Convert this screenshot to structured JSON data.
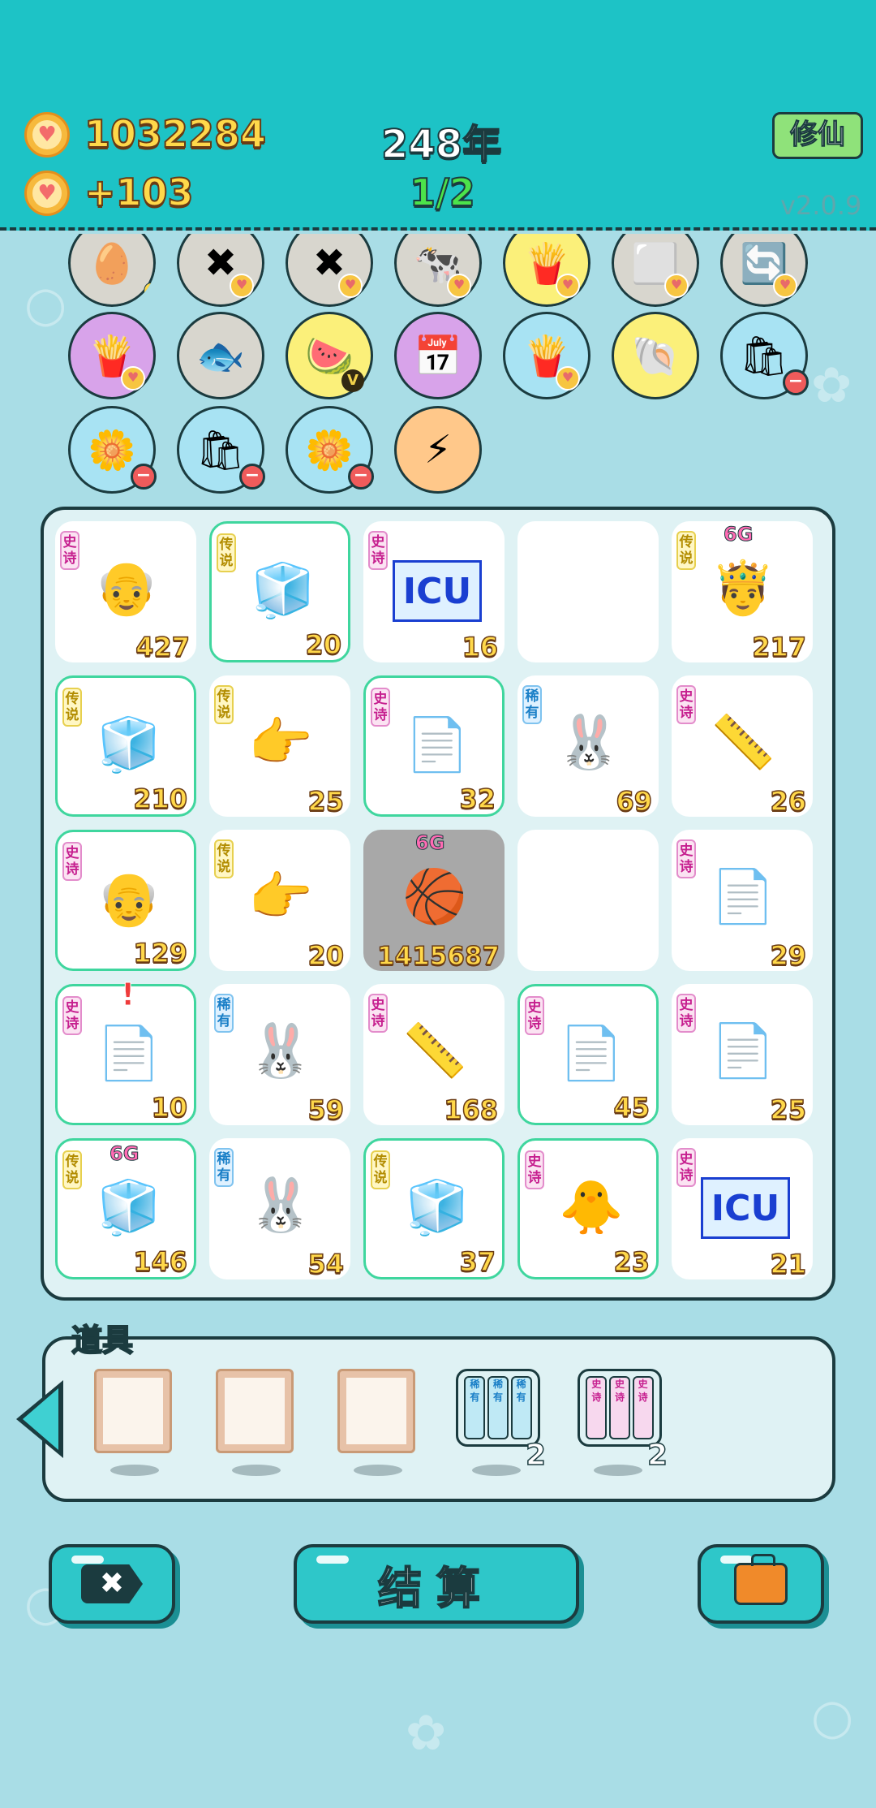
{
  "header": {
    "coins": "1032284",
    "income": "+103",
    "year": "248年",
    "progress": "1/2",
    "xiuxian_label": "修仙",
    "version": "v2.0.9"
  },
  "symbols": [
    {
      "name": "egg-carton",
      "glyph": "🥚",
      "bg": "grey",
      "mark": "zero",
      "mark_text": "0"
    },
    {
      "name": "remove-token",
      "glyph": "✖",
      "bg": "grey",
      "mark": "heart"
    },
    {
      "name": "remove-token",
      "glyph": "✖",
      "bg": "grey",
      "mark": "heart"
    },
    {
      "name": "cows",
      "glyph": "🐄",
      "bg": "grey",
      "mark": "heart"
    },
    {
      "name": "fries",
      "glyph": "🍟",
      "bg": "yellow",
      "mark": "heart"
    },
    {
      "name": "dice-blocks",
      "glyph": "⬜",
      "bg": "grey",
      "mark": "heart"
    },
    {
      "name": "refresh",
      "glyph": "🔄",
      "bg": "grey",
      "mark": "heart"
    },
    {
      "name": "fries",
      "glyph": "🍟",
      "bg": "purple",
      "mark": "heart"
    },
    {
      "name": "fish-bowl",
      "glyph": "🐟",
      "bg": "grey",
      "mark": "none"
    },
    {
      "name": "fruit-basket",
      "glyph": "🍉",
      "bg": "yellow",
      "mark": "v",
      "mark_text": "V"
    },
    {
      "name": "calendar",
      "glyph": "📅",
      "bg": "purple",
      "mark": "none"
    },
    {
      "name": "fries",
      "glyph": "🍟",
      "bg": "blue",
      "mark": "heart"
    },
    {
      "name": "shell",
      "glyph": "🐚",
      "bg": "yellow",
      "mark": "none"
    },
    {
      "name": "trash-bag",
      "glyph": "🛍",
      "bg": "blue",
      "mark": "minus"
    },
    {
      "name": "flower-pot",
      "glyph": "🌼",
      "bg": "blue",
      "mark": "minus"
    },
    {
      "name": "trash-bag",
      "glyph": "🛍",
      "bg": "blue",
      "mark": "minus"
    },
    {
      "name": "flower-pot",
      "glyph": "🌼",
      "bg": "blue",
      "mark": "minus"
    },
    {
      "name": "lightning",
      "glyph": "⚡",
      "bg": "orange",
      "mark": "none"
    }
  ],
  "grid": [
    {
      "tag": "史诗",
      "tag_type": "epic",
      "icon": "old-man",
      "glyph": "👴",
      "value": "427",
      "green": false
    },
    {
      "tag": "传说",
      "tag_type": "legend",
      "icon": "fridge",
      "glyph": "🧊",
      "value": "20",
      "green": true
    },
    {
      "tag": "史诗",
      "tag_type": "epic",
      "icon": "icu",
      "glyph": "ICU",
      "value": "16",
      "green": false
    },
    {
      "tag": "",
      "tag_type": "",
      "icon": "empty",
      "glyph": "",
      "value": "",
      "green": false
    },
    {
      "tag": "传说",
      "tag_type": "legend",
      "icon": "crowned-man",
      "glyph": "🤴",
      "value": "217",
      "green": false,
      "badge": "6G"
    },
    {
      "tag": "传说",
      "tag_type": "legend",
      "icon": "fridge",
      "glyph": "🧊",
      "value": "210",
      "green": true
    },
    {
      "tag": "传说",
      "tag_type": "legend",
      "icon": "pointing-hand-ball",
      "glyph": "👉",
      "value": "25",
      "green": false
    },
    {
      "tag": "史诗",
      "tag_type": "epic",
      "icon": "copy-paste",
      "glyph": "📄",
      "value": "32",
      "green": true
    },
    {
      "tag": "稀有",
      "tag_type": "rare",
      "icon": "rabbit",
      "glyph": "🐰",
      "value": "69",
      "green": false
    },
    {
      "tag": "史诗",
      "tag_type": "epic",
      "icon": "ruler",
      "glyph": "📏",
      "value": "26",
      "green": false
    },
    {
      "tag": "史诗",
      "tag_type": "epic",
      "icon": "old-man",
      "glyph": "👴",
      "value": "129",
      "green": true
    },
    {
      "tag": "传说",
      "tag_type": "legend",
      "icon": "pointing-hand",
      "glyph": "👉",
      "value": "20",
      "green": false
    },
    {
      "tag": "",
      "tag_type": "",
      "icon": "fridge-basketball",
      "glyph": "🏀",
      "value": "1415687",
      "green": false,
      "grey": true,
      "badge": "6G"
    },
    {
      "tag": "",
      "tag_type": "",
      "icon": "empty",
      "glyph": "",
      "value": "",
      "green": false
    },
    {
      "tag": "史诗",
      "tag_type": "epic",
      "icon": "copy-paste",
      "glyph": "📄",
      "value": "29",
      "green": false
    },
    {
      "tag": "史诗",
      "tag_type": "epic",
      "icon": "copy-paste",
      "glyph": "📄",
      "value": "10",
      "green": true,
      "alert": "!"
    },
    {
      "tag": "稀有",
      "tag_type": "rare",
      "icon": "rabbit",
      "glyph": "🐰",
      "value": "59",
      "green": false
    },
    {
      "tag": "史诗",
      "tag_type": "epic",
      "icon": "ruler",
      "glyph": "📏",
      "value": "168",
      "green": false
    },
    {
      "tag": "史诗",
      "tag_type": "epic",
      "icon": "copy-paste",
      "glyph": "📄",
      "value": "45",
      "green": true
    },
    {
      "tag": "史诗",
      "tag_type": "epic",
      "icon": "copy-paste",
      "glyph": "📄",
      "value": "25",
      "green": false
    },
    {
      "tag": "传说",
      "tag_type": "legend",
      "icon": "fridge",
      "glyph": "🧊",
      "value": "146",
      "green": true,
      "badge": "6G"
    },
    {
      "tag": "稀有",
      "tag_type": "rare",
      "icon": "rabbit",
      "glyph": "🐰",
      "value": "54",
      "green": false
    },
    {
      "tag": "传说",
      "tag_type": "legend",
      "icon": "fridge",
      "glyph": "🧊",
      "value": "37",
      "green": true
    },
    {
      "tag": "史诗",
      "tag_type": "epic",
      "icon": "chick-with-hair",
      "glyph": "🐥",
      "value": "23",
      "green": true
    },
    {
      "tag": "史诗",
      "tag_type": "epic",
      "icon": "icu",
      "glyph": "ICU",
      "value": "21",
      "green": false
    }
  ],
  "items": {
    "title": "道具",
    "list": [
      {
        "name": "blank-frame",
        "type": "frame"
      },
      {
        "name": "blank-frame",
        "type": "frame"
      },
      {
        "name": "blank-frame",
        "type": "frame"
      },
      {
        "name": "rare-pack",
        "type": "pack",
        "tier": "rare",
        "label": "稀有",
        "count": "2"
      },
      {
        "name": "epic-pack",
        "type": "pack",
        "tier": "epic",
        "label": "史诗",
        "count": "2"
      }
    ]
  },
  "buttons": {
    "settle": "结算",
    "remove_icon": "✖"
  },
  "icons": {
    "coin": "heart-coin-icon",
    "back": "left-arrow-icon",
    "bag": "briefcase-icon"
  }
}
